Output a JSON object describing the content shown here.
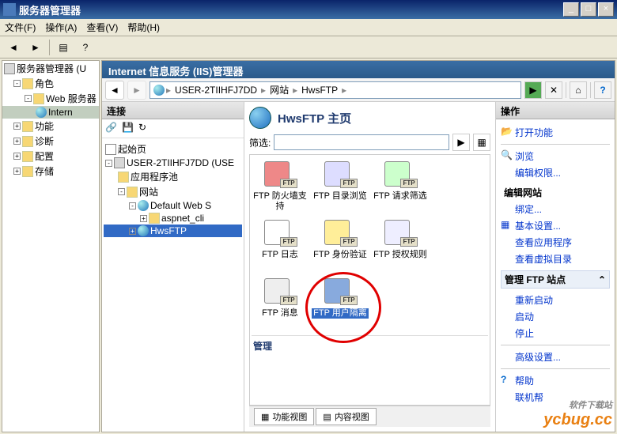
{
  "window": {
    "title": "服务器管理器",
    "min": "_",
    "max": "□",
    "close": "×"
  },
  "menu": {
    "file": "文件(F)",
    "action": "操作(A)",
    "view": "查看(V)",
    "help": "帮助(H)"
  },
  "leftTree": {
    "root": "服务器管理器 (U",
    "roles": "角色",
    "web": "Web 服务器",
    "iis": "Intern",
    "features": "功能",
    "diag": "诊断",
    "config": "配置",
    "storage": "存储"
  },
  "iis": {
    "title": "Internet 信息服务 (IIS)管理器",
    "crumbs": {
      "server": "USER-2TIIHFJ7DD",
      "site": "网站",
      "hws": "HwsFTP"
    },
    "conn": {
      "header": "连接",
      "start": "起始页",
      "server": "USER-2TIIHFJ7DD (USE",
      "appPools": "应用程序池",
      "sites": "网站",
      "default": "Default Web S",
      "aspnet": "aspnet_cli",
      "hws": "HwsFTP"
    },
    "center": {
      "title": "HwsFTP 主页",
      "filter": "筛选:",
      "group_manage": "管理",
      "tabs": {
        "features": "功能视图",
        "content": "内容视图"
      },
      "items": {
        "firewall": "FTP 防火墙支持",
        "dirbrowse": "FTP 目录浏览",
        "reqfilter": "FTP 请求筛选",
        "log": "FTP 日志",
        "auth": "FTP 身份验证",
        "authz": "FTP 授权规则",
        "messages": "FTP 消息",
        "useriso": "FTP 用户隔离",
        "badge": "FTP"
      }
    },
    "actions": {
      "header": "操作",
      "open": "打开功能",
      "browse": "浏览",
      "editperm": "编辑权限...",
      "editsite": "编辑网站",
      "bindings": "绑定...",
      "basic": "基本设置...",
      "viewapps": "查看应用程序",
      "viewvdirs": "查看虚拟目录",
      "managesite": "管理 FTP 站点",
      "restart": "重新启动",
      "start": "启动",
      "stop": "停止",
      "advanced": "高级设置...",
      "help": "帮助",
      "onlinehelp": "联机帮"
    }
  },
  "watermark": {
    "sub": "软件下载站",
    "main": "ycbug.cc"
  }
}
